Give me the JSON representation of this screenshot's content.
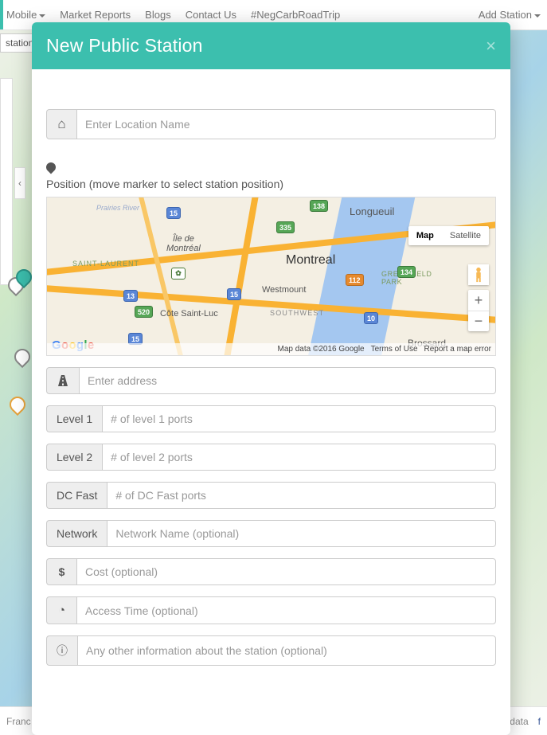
{
  "nav": {
    "items": [
      "Mobile",
      "Market Reports",
      "Blogs",
      "Contact Us",
      "#NegCarbRoadTrip"
    ],
    "add_station": "Add Station"
  },
  "bg": {
    "station_label": "station",
    "footer_left": "Franc",
    "footer_right": "Map data",
    "collapse_glyph": "‹"
  },
  "modal": {
    "title": "New Public Station",
    "close": "×",
    "location_placeholder": "Enter Location Name",
    "position_label": "Position (move marker to select station position)",
    "address_placeholder": "Enter address",
    "levels": {
      "l1_label": "Level 1",
      "l1_placeholder": "# of level 1 ports",
      "l2_label": "Level 2",
      "l2_placeholder": "# of level 2 ports",
      "dc_label": "DC Fast",
      "dc_placeholder": "# of DC Fast ports"
    },
    "network_label": "Network",
    "network_placeholder": "Network Name (optional)",
    "cost_placeholder": "Cost (optional)",
    "access_placeholder": "Access Time (optional)",
    "info_placeholder": "Any other information about the station (optional)"
  },
  "map": {
    "type_map": "Map",
    "type_sat": "Satellite",
    "zoom_in": "+",
    "zoom_out": "−",
    "labels": {
      "montreal": "Montreal",
      "ile": "Île de\nMontréal",
      "longueuil": "Longueuil",
      "westmount": "Westmount",
      "csl": "Côte Saint-Luc",
      "southwest": "SOUTHWEST",
      "saintlaurent": "SAINT-LAURENT",
      "greenfield": "GREENFIELD\nPARK",
      "brossard": "Brossard",
      "prairies": "Prairies River"
    },
    "shields": {
      "s15a": "15",
      "s15b": "15",
      "s15c": "15",
      "s520": "520",
      "s13": "13",
      "s335": "335",
      "s138": "138",
      "s10": "10",
      "s112": "112",
      "s134": "134"
    },
    "attr": {
      "data": "Map data ©2016 Google",
      "terms": "Terms of Use",
      "report": "Report a map error"
    }
  }
}
